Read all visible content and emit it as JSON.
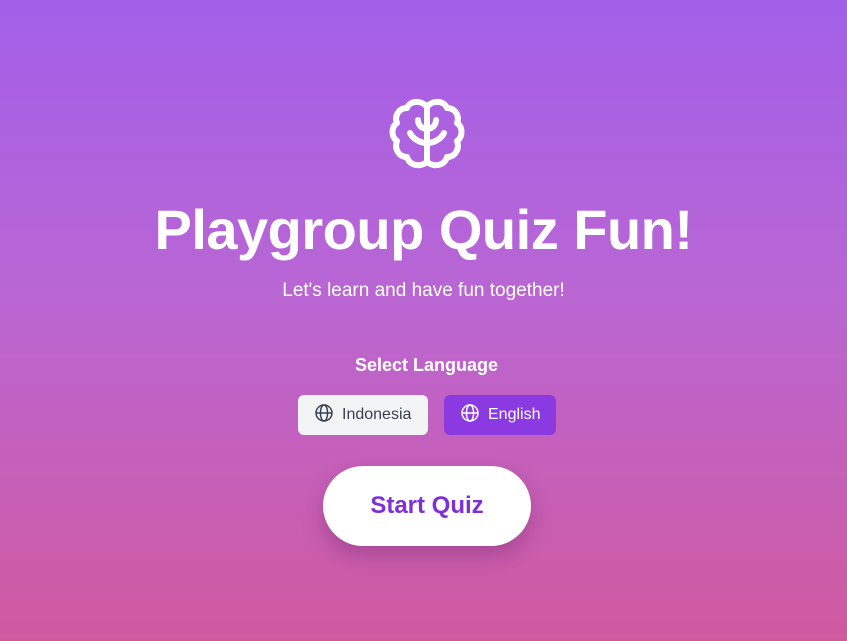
{
  "hero": {
    "icon": "brain-icon",
    "title": "Playgroup Quiz Fun!",
    "subtitle": "Let's learn and have fun together!"
  },
  "language": {
    "heading": "Select Language",
    "options": [
      {
        "label": "Indonesia",
        "icon": "globe-icon",
        "selected": false
      },
      {
        "label": "English",
        "icon": "globe-icon",
        "selected": true
      }
    ]
  },
  "actions": {
    "start_label": "Start Quiz"
  },
  "colors": {
    "background_top": "#a25fe8",
    "background_bottom": "#d15a9f",
    "accent": "#8b3ae2",
    "start_text": "#7e2fd8"
  }
}
